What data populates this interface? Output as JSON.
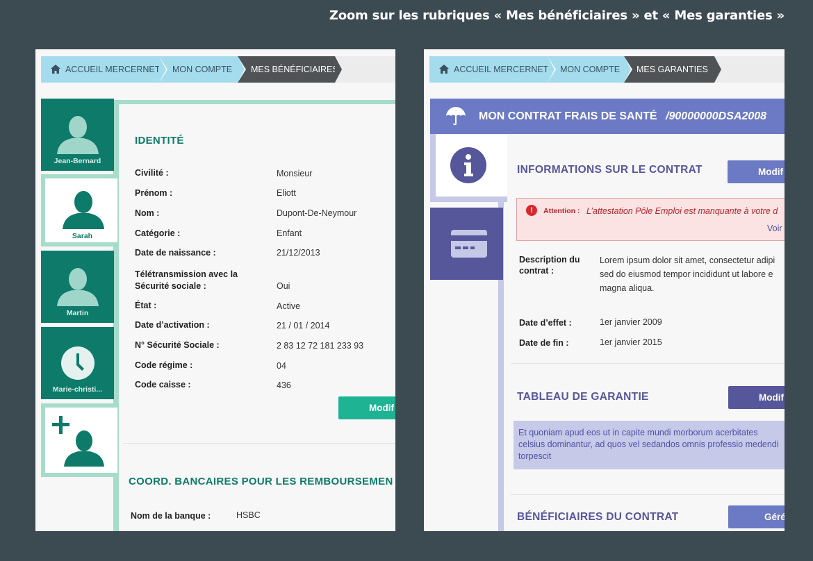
{
  "caption": "Zoom sur les rubriques « Mes bénéficiaires » et « Mes garanties »",
  "colors": {
    "teal": "#0d7a6a",
    "teal_light": "#a6dcca",
    "button_green": "#1db393",
    "purple": "#5a5da5",
    "purple_light": "#6c79c4"
  },
  "left": {
    "breadcrumb": {
      "home": "ACCUEIL MERCERNET",
      "account": "MON COMPTE",
      "current": "MES BÉNÉFICIAIRES"
    },
    "beneficiaries": [
      {
        "name": "Jean-Bernard",
        "icon": "person-icon"
      },
      {
        "name": "Sarah",
        "icon": "person-icon"
      },
      {
        "name": "Martin",
        "icon": "person-icon"
      },
      {
        "name": "Marie-christi...",
        "icon": "clock-icon"
      }
    ],
    "add_icon": "add-person-icon",
    "identity": {
      "title": "IDENTITÉ",
      "fields": [
        {
          "label": "Civilité :",
          "value": "Monsieur"
        },
        {
          "label": "Prénom :",
          "value": "Eliott"
        },
        {
          "label": "Nom :",
          "value": "Dupont-De-Neymour"
        },
        {
          "label": "Catégorie :",
          "value": "Enfant"
        },
        {
          "label": "Date de naissance :",
          "value": "21/12/2013"
        },
        {
          "label": "Télétransmission avec la Sécurité sociale :",
          "value": "Oui"
        },
        {
          "label": "État :",
          "value": "Active"
        },
        {
          "label": "Date d’activation :",
          "value": "21 / 01 / 2014"
        },
        {
          "label": "N° Sécurité Sociale :",
          "value": "2 83 12 72 181 233 93"
        },
        {
          "label": "Code régime :",
          "value": "04"
        },
        {
          "label": "Code caisse :",
          "value": "436"
        }
      ],
      "modify_button": "Modif"
    },
    "bank": {
      "title": "COORD. BANCAIRES POUR LES REMBOURSEMEN",
      "bank_label": "Nom de la banque :",
      "bank_value": "HSBC"
    }
  },
  "right": {
    "breadcrumb": {
      "home": "ACCUEIL MERCERNET",
      "account": "MON COMPTE",
      "current": "MES GARANTIES"
    },
    "contract": {
      "title": "MON CONTRAT FRAIS DE SANTÉ",
      "number": "/90000000DSA2008"
    },
    "info": {
      "title": "INFORMATIONS SUR LE CONTRAT",
      "modify_button": "Modif"
    },
    "alert": {
      "label": "Attention :",
      "message": "L’attestation Pôle Emploi est manquante à votre d",
      "link": "Voir"
    },
    "description": {
      "label": "Description du contrat :",
      "value": "Lorem ipsum dolor sit amet, consectetur adipi sed do eiusmod tempor incididunt ut labore e magna aliqua."
    },
    "dates": [
      {
        "label": "Date d’effet :",
        "value": "1er janvier 2009"
      },
      {
        "label": "Date de fin :",
        "value": "1er janvier 2015"
      }
    ],
    "garantie": {
      "title": "TABLEAU DE GARANTIE",
      "modify_button": "Modif",
      "note": "Et quoniam apud eos ut in capite mundi morborum acerbitates celsius dominantur, ad quos vel sedandos omnis professio medendi torpescit"
    },
    "beneficiaires": {
      "title": "BÉNÉFICIAIRES DU CONTRAT",
      "manage_button": "Géré"
    }
  }
}
